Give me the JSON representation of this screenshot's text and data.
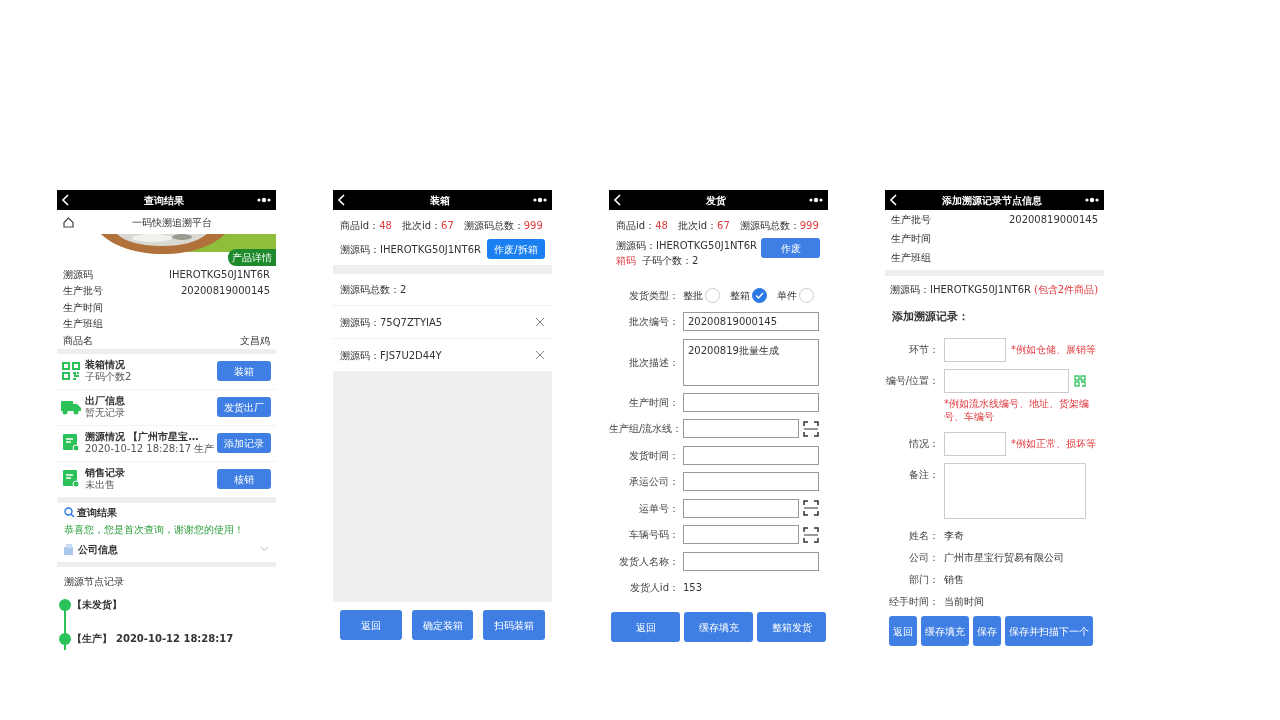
{
  "screens": [
    {
      "kind": "query",
      "title": "查询结果",
      "header": "一码快溯追溯平台",
      "badge": "产品详情",
      "info": [
        {
          "label": "溯源码",
          "value": "IHEROTKG50J1NT6R"
        },
        {
          "label": "生产批号",
          "value": "20200819000145"
        },
        {
          "label": "生产时间"
        },
        {
          "label": "生产班组"
        },
        {
          "label": "商品名",
          "value": "文昌鸡"
        }
      ],
      "sections": [
        {
          "kind": "qr",
          "title": "装箱情况",
          "subtitle": "子码个数2",
          "button": "装箱"
        },
        {
          "kind": "truck",
          "title": "出厂信息",
          "subtitle": "暂无记录",
          "button": "发货出厂"
        },
        {
          "kind": "doc",
          "title": "溯源情况 【广州市星宝…",
          "subtitle": "2020-10-12 18:28:17 生产",
          "button": "添加记录"
        },
        {
          "kind": "doc",
          "title": "销售记录",
          "subtitle": "未出售",
          "button": "核销"
        }
      ],
      "result": {
        "title": "查询结果",
        "message": "恭喜您，您是首次查询，谢谢您的使用！"
      },
      "company": "公司信息",
      "timeline_title": "溯源节点记录",
      "timeline": [
        {
          "tag": "【未发货】"
        },
        {
          "tag": "【生产】",
          "time": "2020-10-12 18:28:17"
        }
      ]
    },
    {
      "kind": "packing",
      "title": "装箱",
      "stats": [
        {
          "label": "商品id：",
          "value": "48"
        },
        {
          "label": "批次id：",
          "value": "67"
        },
        {
          "label": "溯源码总数：",
          "value": "999"
        }
      ],
      "code": "溯源码：IHEROTKG50J1NT6R",
      "action": "作废/拆箱",
      "count": "溯源码总数：2",
      "codes": [
        "溯源码：75Q7ZTYIA5",
        "溯源码：FJS7U2D44Y"
      ],
      "buttons": [
        "返回",
        "确定装箱",
        "扫码装箱"
      ]
    },
    {
      "kind": "shipping",
      "title": "发货",
      "stats": [
        {
          "label": "商品id：",
          "value": "48"
        },
        {
          "label": "批次id：",
          "value": "67"
        },
        {
          "label": "溯源码总数：",
          "value": "999"
        }
      ],
      "code": "溯源码：IHEROTKG50J1NT6R",
      "action": "作废",
      "box_tag": "箱码",
      "child_count": "子码个数：2",
      "ship_type": {
        "label": "发货类型：",
        "options": [
          {
            "label": "整批",
            "selected": false
          },
          {
            "label": "整箱",
            "selected": true
          },
          {
            "label": "单件",
            "selected": false
          }
        ]
      },
      "fields": [
        {
          "kind": "input",
          "label": "批次编号：",
          "value": "20200819000145"
        },
        {
          "kind": "textarea",
          "label": "批次描述：",
          "value": "20200819批量生成"
        },
        {
          "kind": "input",
          "label": "生产时间："
        },
        {
          "kind": "scan",
          "label": "生产组/流水线："
        },
        {
          "kind": "input",
          "label": "发货时间："
        },
        {
          "kind": "input",
          "label": "承运公司："
        },
        {
          "kind": "scan",
          "label": "运单号："
        },
        {
          "kind": "scan",
          "label": "车辆号码："
        },
        {
          "kind": "input",
          "label": "发货人名称："
        },
        {
          "kind": "text",
          "label": "发货人id：",
          "value": "153"
        }
      ],
      "buttons": [
        "返回",
        "缓存填充",
        "整箱发货"
      ]
    },
    {
      "kind": "add_record",
      "title": "添加溯源记录节点信息",
      "info": [
        {
          "label": "生产批号",
          "value": "20200819000145"
        },
        {
          "label": "生产时间"
        },
        {
          "label": "生产班组"
        }
      ],
      "code": "溯源码：IHEROTKG50J1NT6R",
      "code_note": "(包含2件商品)",
      "heading": "添加溯源记录：",
      "fields": [
        {
          "kind": "short",
          "label": "环节：",
          "hint": "*例如仓储、展销等"
        },
        {
          "kind": "qr",
          "label": "编号/位置：",
          "hint": "*例如流水线编号、地址、货架编号、车编号"
        },
        {
          "kind": "short",
          "label": "情况：",
          "hint": "*例如正常、损坏等"
        },
        {
          "kind": "textarea",
          "label": "备注："
        },
        {
          "kind": "text",
          "label": "姓名：",
          "value": "李奇"
        },
        {
          "kind": "text",
          "label": "公司：",
          "value": "广州市星宝行贸易有限公司"
        },
        {
          "kind": "text",
          "label": "部门：",
          "value": "销售"
        },
        {
          "kind": "text",
          "label": "经手时间：",
          "value": "当前时间"
        }
      ],
      "buttons": [
        "返回",
        "缓存填充",
        "保存",
        "保存并扫描下一个"
      ]
    }
  ]
}
